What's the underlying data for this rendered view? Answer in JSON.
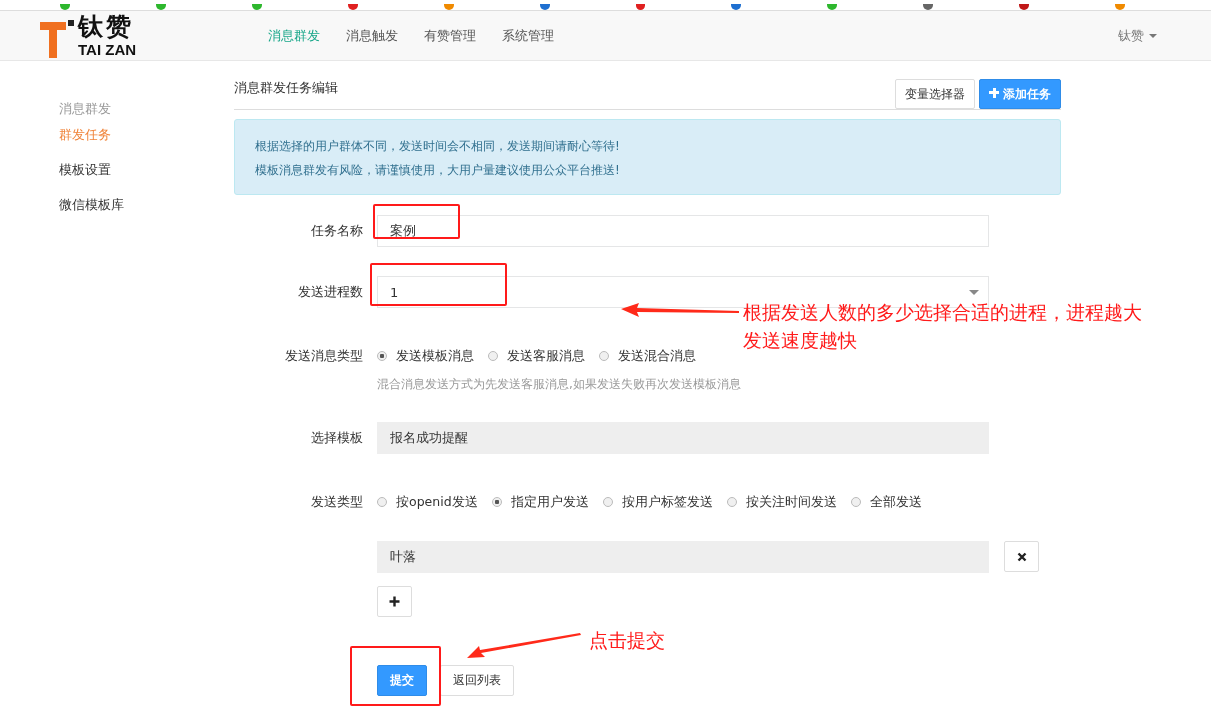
{
  "brand": {
    "name": "钛赞",
    "subtitle": "TAI ZAN"
  },
  "nav": [
    {
      "label": "消息群发",
      "selected": true
    },
    {
      "label": "消息触发",
      "selected": false
    },
    {
      "label": "有赞管理",
      "selected": false
    },
    {
      "label": "系统管理",
      "selected": false
    }
  ],
  "user_menu": {
    "label": "钛赞"
  },
  "sidebar": {
    "title": "消息群发",
    "items": [
      {
        "label": "群发任务",
        "selected": true
      },
      {
        "label": "模板设置",
        "selected": false
      },
      {
        "label": "微信模板库",
        "selected": false
      }
    ]
  },
  "page_title": "消息群发任务编辑",
  "toolbar": [
    {
      "label": "变量选择器",
      "kind": "default"
    },
    {
      "label": "添加任务",
      "kind": "primary"
    }
  ],
  "alert": [
    "根据选择的用户群体不同，发送时间会不相同，发送期间请耐心等待!",
    "模板消息群发有风险，请谨慎使用，大用户量建议使用公众平台推送!"
  ],
  "form": [
    {
      "kind": "text",
      "label": "任务名称",
      "value": "案例"
    },
    {
      "kind": "select",
      "label": "发送进程数",
      "value": "1"
    },
    {
      "kind": "radio",
      "label": "发送消息类型",
      "options": [
        {
          "label": "发送模板消息",
          "selected": true
        },
        {
          "label": "发送客服消息",
          "selected": false
        },
        {
          "label": "发送混合消息",
          "selected": false
        }
      ],
      "hint": "混合消息发送方式为先发送客服消息,如果发送失败再次发送模板消息"
    },
    {
      "kind": "readonly",
      "label": "选择模板",
      "value": "报名成功提醒"
    },
    {
      "kind": "radio",
      "label": "发送类型",
      "options": [
        {
          "label": "按openid发送",
          "selected": false
        },
        {
          "label": "指定用户发送",
          "selected": true
        },
        {
          "label": "按用户标签发送",
          "selected": false
        },
        {
          "label": "按关注时间发送",
          "selected": false
        },
        {
          "label": "全部发送",
          "selected": false
        }
      ]
    },
    {
      "kind": "removable",
      "value": "叶落"
    },
    {
      "kind": "add"
    }
  ],
  "actions": [
    {
      "label": "提交",
      "kind": "primary"
    },
    {
      "label": "返回列表",
      "kind": "default"
    }
  ],
  "annotations": [
    {
      "kind": "arrow-note",
      "lines": [
        "根据发送人数的多少选择合适的进程，进程越大",
        "发送速度越快"
      ]
    },
    {
      "kind": "arrow-note",
      "lines": [
        "点击提交"
      ]
    }
  ]
}
